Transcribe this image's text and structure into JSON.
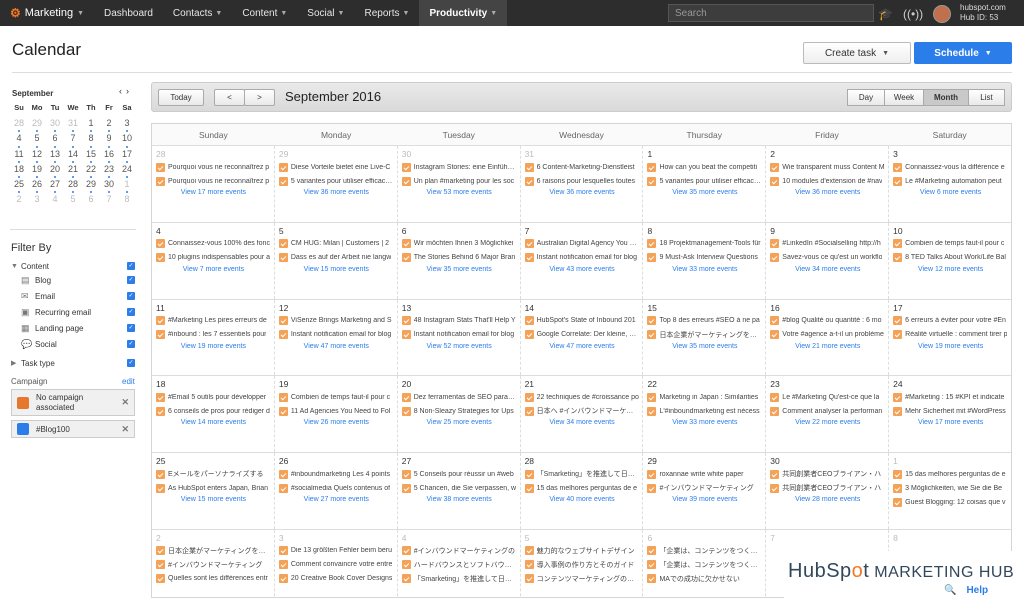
{
  "topnav": {
    "brand": "Marketing",
    "items": [
      "Dashboard",
      "Contacts",
      "Content",
      "Social",
      "Reports",
      "Productivity"
    ],
    "search_placeholder": "Search",
    "account_domain": "hubspot.com",
    "account_hub": "Hub ID: 53"
  },
  "header": {
    "title": "Calendar",
    "create_task": "Create task",
    "schedule": "Schedule"
  },
  "mini_calendar": {
    "month": "September",
    "weekday_heads": [
      "Su",
      "Mo",
      "Tu",
      "We",
      "Th",
      "Fr",
      "Sa"
    ],
    "weeks": [
      [
        "28",
        "29",
        "30",
        "31",
        "1",
        "2",
        "3"
      ],
      [
        "4",
        "5",
        "6",
        "7",
        "8",
        "9",
        "10"
      ],
      [
        "11",
        "12",
        "13",
        "14",
        "15",
        "16",
        "17"
      ],
      [
        "18",
        "19",
        "20",
        "21",
        "22",
        "23",
        "24"
      ],
      [
        "25",
        "26",
        "27",
        "28",
        "29",
        "30",
        "1"
      ],
      [
        "2",
        "3",
        "4",
        "5",
        "6",
        "7",
        "8"
      ]
    ]
  },
  "filter": {
    "title": "Filter By",
    "content_label": "Content",
    "content_items": [
      "Blog",
      "Email",
      "Recurring email",
      "Landing page",
      "Social"
    ],
    "task_type": "Task type",
    "campaign_label": "Campaign",
    "campaign_edit": "edit",
    "campaigns": [
      {
        "name": "No campaign associated",
        "color": "#e8772e"
      },
      {
        "name": "#Blog100",
        "color": "#2b7de9"
      }
    ]
  },
  "toolbar": {
    "today": "Today",
    "prev": "<",
    "next": ">",
    "title": "September 2016",
    "views": [
      "Day",
      "Week",
      "Month",
      "List"
    ],
    "active_view": "Month"
  },
  "calendar": {
    "weekdays": [
      "Sunday",
      "Monday",
      "Tuesday",
      "Wednesday",
      "Thursday",
      "Friday",
      "Saturday"
    ],
    "weeks": [
      [
        {
          "d": "28",
          "o": true,
          "e": [
            "Pourquoi vous ne reconnaîtrez p",
            "Pourquoi vous ne reconnaîtrez p"
          ],
          "m": "View 17 more events"
        },
        {
          "d": "29",
          "o": true,
          "e": [
            "Diese Vorteile bietet eine Live-C",
            "5 variantes pour utiliser efficacem"
          ],
          "m": "View 36 more events"
        },
        {
          "d": "30",
          "o": true,
          "e": [
            "Instagram Stories: eine Einführun",
            "Un plan #marketing pour les soc"
          ],
          "m": "View 53 more events"
        },
        {
          "d": "31",
          "o": true,
          "e": [
            "6 Content-Marketing-Dienstleist",
            "6 raisons pour lesquelles toutes"
          ],
          "m": "View 36 more events"
        },
        {
          "d": "1",
          "o": false,
          "e": [
            "How can you beat the competiti",
            "5 variantes pour utiliser efficacem"
          ],
          "m": "View 35 more events"
        },
        {
          "d": "2",
          "o": false,
          "e": [
            "Wie transparent muss Content M",
            "10 modules d'extension de #nav"
          ],
          "m": "View 36 more events"
        },
        {
          "d": "3",
          "o": false,
          "e": [
            "Connaissez-vous la différence e",
            "Le #Marketing automation peut"
          ],
          "m": "View 6 more events"
        }
      ],
      [
        {
          "d": "4",
          "o": false,
          "e": [
            "Connaissez-vous 100% des fonc",
            "10 plugins indispensables pour a"
          ],
          "m": "View 7 more events"
        },
        {
          "d": "5",
          "o": false,
          "e": [
            "CM HUG: Milan | Customers | 2",
            "Dass es auf der Arbeit nie langw"
          ],
          "m": "View 15 more events"
        },
        {
          "d": "6",
          "o": false,
          "e": [
            "Wir möchten Ihnen 3 Möglichkei",
            "The Stories Behind 6 Major Bran"
          ],
          "m": "View 35 more events"
        },
        {
          "d": "7",
          "o": false,
          "e": [
            "Australian Digital Agency You & C",
            "Instant notification email for blog"
          ],
          "m": "View 43 more events"
        },
        {
          "d": "8",
          "o": false,
          "e": [
            "18 Projektmanagement-Tools für",
            "9 Must-Ask Interview Questions"
          ],
          "m": "View 33 more events"
        },
        {
          "d": "9",
          "o": false,
          "e": [
            "#LinkedIn #Socialselling http://h",
            "Savez-vous ce qu'est un workflo"
          ],
          "m": "View 34 more events"
        },
        {
          "d": "10",
          "o": false,
          "e": [
            "Combien de temps faut-il pour c",
            "8 TED Talks About Work/Life Bal"
          ],
          "m": "View 12 more events"
        }
      ],
      [
        {
          "d": "11",
          "o": false,
          "e": [
            "#Marketing Les pires erreurs de",
            "#inbound : les 7 essentiels pour"
          ],
          "m": "View 19 more events"
        },
        {
          "d": "12",
          "o": false,
          "e": [
            "ViSenze Brings Marketing and S",
            "Instant notification email for blog"
          ],
          "m": "View 47 more events"
        },
        {
          "d": "13",
          "o": false,
          "e": [
            "48 Instagram Stats That'll Help Y",
            "Instant notification email for blog"
          ],
          "m": "View 52 more events"
        },
        {
          "d": "14",
          "o": false,
          "e": [
            "HubSpot's State of Inbound 201",
            "Google Correlate: Der kleine, unb"
          ],
          "m": "View 47 more events"
        },
        {
          "d": "15",
          "o": false,
          "e": [
            "Top 8 des erreurs #SEO à ne pa",
            "日本企業がマーケティングを「自"
          ],
          "m": "View 35 more events"
        },
        {
          "d": "16",
          "o": false,
          "e": [
            "#blog Qualité ou quantité : 6 mo",
            "Votre #agence a-t-il un problème"
          ],
          "m": "View 21 more events"
        },
        {
          "d": "17",
          "o": false,
          "e": [
            "6 erreurs à éviter pour votre #En",
            "Réalité virtuelle : comment tirer p"
          ],
          "m": "View 19 more events"
        }
      ],
      [
        {
          "d": "18",
          "o": false,
          "e": [
            "#Email 5 outils pour développer",
            "6 conseils de pros pour rédiger d"
          ],
          "m": "View 14 more events"
        },
        {
          "d": "19",
          "o": false,
          "e": [
            "Combien de temps faut-il pour c",
            "11 Ad Agencies You Need to Fol"
          ],
          "m": "View 26 more events"
        },
        {
          "d": "20",
          "o": false,
          "e": [
            "Dez ferramentas de SEO para au",
            "8 Non-Sleazy Strategies for Ups"
          ],
          "m": "View 25 more events"
        },
        {
          "d": "21",
          "o": false,
          "e": [
            "22 techniques de #croissance po",
            "日本へ #インバウンドマーケティ"
          ],
          "m": "View 34 more events"
        },
        {
          "d": "22",
          "o": false,
          "e": [
            "Marketing in Japan : Similarities",
            "L'#inboundmarketing est nécess"
          ],
          "m": "View 33 more events"
        },
        {
          "d": "23",
          "o": false,
          "e": [
            "Le #Marketing Qu'est-ce que la",
            "Comment analyser la performan"
          ],
          "m": "View 22 more events"
        },
        {
          "d": "24",
          "o": false,
          "e": [
            "#Marketing : 15 #KPI et indicate",
            "Mehr Sicherheit mit #WordPress"
          ],
          "m": "View 17 more events"
        }
      ],
      [
        {
          "d": "25",
          "o": false,
          "e": [
            "Eメールをパーソナライズする",
            "As HubSpot enters Japan, Brian"
          ],
          "m": "View 15 more events"
        },
        {
          "d": "26",
          "o": false,
          "e": [
            "#inboundmarketing Les 4 points",
            "#socialmedia Quels contenus of"
          ],
          "m": "View 27 more events"
        },
        {
          "d": "27",
          "o": false,
          "e": [
            "5 Conseils pour réussir un #web",
            "5 Chancen, die Sie verpassen, w"
          ],
          "m": "View 38 more events"
        },
        {
          "d": "28",
          "o": false,
          "e": [
            "「Smarketing」を推進して日本市",
            "15 das melhores perguntas de e"
          ],
          "m": "View 40 more events"
        },
        {
          "d": "29",
          "o": false,
          "e": [
            "roxannae write white paper",
            "#インバウンドマーケティング"
          ],
          "m": "View 39 more events"
        },
        {
          "d": "30",
          "o": false,
          "e": [
            "共同創業者CEOブライアン・ハ",
            "共同創業者CEOブライアン・ハ"
          ],
          "m": "View 28 more events"
        },
        {
          "d": "1",
          "o": true,
          "e": [
            "15 das melhores perguntas de e",
            "3 Möglichkeiten, wie Sie die Be",
            "Guest Blogging: 12 coisas que v"
          ],
          "m": ""
        }
      ],
      [
        {
          "d": "2",
          "o": true,
          "e": [
            "日本企業がマーケティングを「自",
            "#インバウンドマーケティング",
            "Quelles sont les différences entr"
          ],
          "m": ""
        },
        {
          "d": "3",
          "o": true,
          "e": [
            "Die 13 größten Fehler beim beru",
            "Comment convaincre votre entre",
            "20 Creative Book Cover Designs"
          ],
          "m": ""
        },
        {
          "d": "4",
          "o": true,
          "e": [
            "#インバウンドマーケティングの",
            "ハードバウンスとソフトバウンス",
            "「Smarketing」を推進して日本市"
          ],
          "m": ""
        },
        {
          "d": "5",
          "o": true,
          "e": [
            "魅力的なウェブサイトデザイン",
            "導入事例の作り方とそのガイド",
            "コンテンツマーケティングの始め"
          ],
          "m": ""
        },
        {
          "d": "6",
          "o": true,
          "e": [
            "「企業は、コンテンツをつくりた",
            "「企業は、コンテンツをつくりた",
            "MAでの成功に欠かせない"
          ],
          "m": ""
        },
        {
          "d": "7",
          "o": true,
          "e": [
            "",
            "",
            ""
          ],
          "m": ""
        },
        {
          "d": "8",
          "o": true,
          "e": [
            "",
            "",
            ""
          ],
          "m": ""
        }
      ]
    ]
  },
  "overlay": {
    "logo_pre": "HubSp",
    "logo_o": "o",
    "logo_post": "t",
    "logo_suffix": " MARKETING HUB",
    "help": "Help"
  }
}
